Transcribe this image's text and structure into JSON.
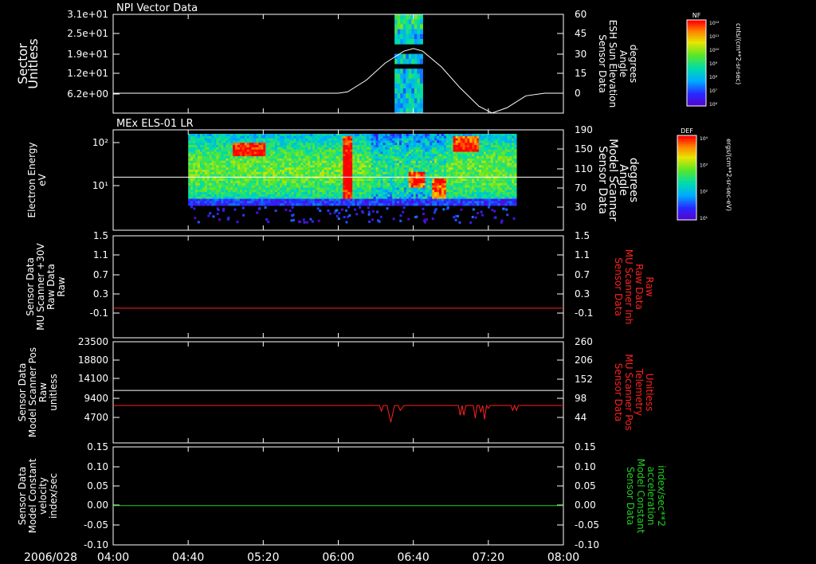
{
  "time_axis": {
    "date": "2006/028",
    "ticks": [
      "04:00",
      "04:40",
      "05:20",
      "06:00",
      "06:40",
      "07:20",
      "08:00"
    ],
    "start": "04:00",
    "end": "08:00"
  },
  "colors": {
    "white": "#ffffff",
    "red": "#ff2020",
    "green": "#20d020",
    "black": "#000000"
  },
  "colorbars": [
    {
      "tag": "NF",
      "unit": "cnts/(cm**2-sr-sec)",
      "ticks": [
        "10¹²",
        "10¹¹",
        "10¹⁰",
        "10⁹",
        "10⁸",
        "10⁷",
        "10⁶"
      ]
    },
    {
      "tag": "DEF",
      "unit": "ergs/(cm**2-sr-sec-eV)",
      "ticks": [
        "10⁴",
        "10³",
        "10²",
        "10¹"
      ]
    }
  ],
  "chart_data": [
    {
      "type": "heatmap",
      "title": "NPI Vector Data",
      "ylabel": "Sector\nUnitless",
      "yticks": [
        "3.1e+01",
        "2.5e+01",
        "1.9e+01",
        "1.2e+01",
        "6.2e+00"
      ],
      "right_ylabel": "Sensor Data\nESH Sun Elevation\nAngle\ndegrees",
      "right_yticks": [
        "60",
        "45",
        "30",
        "15",
        "0"
      ],
      "right_ylim": [
        -15,
        60
      ],
      "heatmap_time_range": [
        "06:30",
        "06:45"
      ],
      "series": [
        {
          "name": "ESH Sun Elevation Angle",
          "color": "#ffffff",
          "axis": "right",
          "x": [
            "04:00",
            "05:00",
            "06:00",
            "06:05",
            "06:15",
            "06:25",
            "06:35",
            "06:40",
            "06:45",
            "06:55",
            "07:05",
            "07:15",
            "07:22",
            "07:30",
            "07:40",
            "07:50",
            "08:00"
          ],
          "y": [
            0,
            0,
            0,
            1,
            10,
            23,
            32,
            34,
            32,
            20,
            4,
            -10,
            -15,
            -11,
            -2,
            0,
            0
          ]
        }
      ]
    },
    {
      "type": "heatmap",
      "title": "MEx ELS-01 LR",
      "ylabel": "Electron Energy\neV",
      "yticks": [
        "10²",
        "10¹"
      ],
      "ylim_log10": [
        0.4,
        2.3
      ],
      "right_ylabel": "Sensor Data\nModel Scanner\nAngle\ndegrees",
      "right_yticks": [
        "190",
        "150",
        "110",
        "70",
        "30"
      ],
      "right_ylim": [
        0,
        190
      ],
      "heatmap_time_range": [
        "04:40",
        "07:35"
      ],
      "series": [
        {
          "name": "Model Scanner Angle",
          "color": "#ffffff",
          "axis": "right",
          "x": [
            "04:00",
            "08:00"
          ],
          "y": [
            92,
            92
          ]
        }
      ]
    },
    {
      "type": "line",
      "ylabel": "Sensor Data\nMU Scanner +30V\nRaw Data\nRaw",
      "yticks": [
        "1.5",
        "1.1",
        "0.7",
        "0.3",
        "-0.1"
      ],
      "ylim": [
        -0.3,
        1.5
      ],
      "right_ylabel": "Sensor Data\nMU Scanner Inh\nRaw Data\nRaw",
      "right_yticks": [
        "1.5",
        "1.1",
        "0.7",
        "0.3",
        "-0.1"
      ],
      "right_ylim": [
        -0.3,
        1.5
      ],
      "series": [
        {
          "name": "MU Scanner Inh",
          "color": "#ff2020",
          "axis": "right",
          "x": [
            "04:00",
            "08:00"
          ],
          "y": [
            0.0,
            0.0
          ]
        }
      ]
    },
    {
      "type": "line",
      "ylabel": "Sensor Data\nModel Scanner Pos\nRaw\nunitless",
      "yticks": [
        "23500",
        "18800",
        "14100",
        "9400",
        "4700"
      ],
      "ylim": [
        0,
        23500
      ],
      "right_ylabel": "Sensor Data\nMU Scanner Pos\nTelemetry\nUnitless",
      "right_yticks": [
        "260",
        "206",
        "152",
        "98",
        "44"
      ],
      "right_ylim": [
        -10,
        260
      ],
      "series": [
        {
          "name": "Model Scanner Pos",
          "color": "#ffffff",
          "axis": "left",
          "x": [
            "04:00",
            "08:00"
          ],
          "y": [
            11400,
            11400
          ]
        },
        {
          "name": "MU Scanner Pos",
          "color": "#ff2020",
          "axis": "right",
          "x": [
            "04:00",
            "06:22",
            "06:23",
            "06:24",
            "06:26",
            "06:28",
            "06:30",
            "06:31",
            "06:32",
            "06:33",
            "06:35",
            "06:36",
            "06:37",
            "06:38",
            "06:39",
            "07:04",
            "07:05",
            "07:06",
            "07:07",
            "07:08",
            "07:09",
            "07:10",
            "07:12",
            "07:13",
            "07:14",
            "07:15",
            "07:16",
            "07:17",
            "07:18",
            "07:19",
            "07:20",
            "07:21",
            "07:22",
            "07:23",
            "07:24",
            "07:32",
            "07:33",
            "07:34",
            "07:35",
            "07:36",
            "08:00"
          ],
          "y": [
            78,
            78,
            62,
            78,
            78,
            30,
            78,
            78,
            78,
            64,
            78,
            78,
            78,
            78,
            78,
            78,
            50,
            78,
            50,
            78,
            78,
            78,
            78,
            42,
            78,
            78,
            60,
            78,
            38,
            78,
            70,
            78,
            78,
            78,
            78,
            78,
            64,
            78,
            64,
            78,
            78
          ]
        }
      ]
    },
    {
      "type": "line",
      "ylabel": "Sensor Data\nModel Constant\nvelocity\nindex/sec",
      "yticks": [
        "0.15",
        "0.10",
        "0.05",
        "0.00",
        "-0.05",
        "-0.10"
      ],
      "ylim": [
        -0.1,
        0.15
      ],
      "right_ylabel": "Sensor Data\nModel Constant\nacceleration\nindex/sec**2",
      "right_yticks": [
        "0.15",
        "0.10",
        "0.05",
        "0.00",
        "-0.05",
        "-0.10"
      ],
      "right_ylim": [
        -0.1,
        0.15
      ],
      "series": [
        {
          "name": "Model Constant acceleration",
          "color": "#20d020",
          "axis": "right",
          "x": [
            "04:00",
            "08:00"
          ],
          "y": [
            0.0,
            0.0
          ]
        }
      ]
    }
  ]
}
